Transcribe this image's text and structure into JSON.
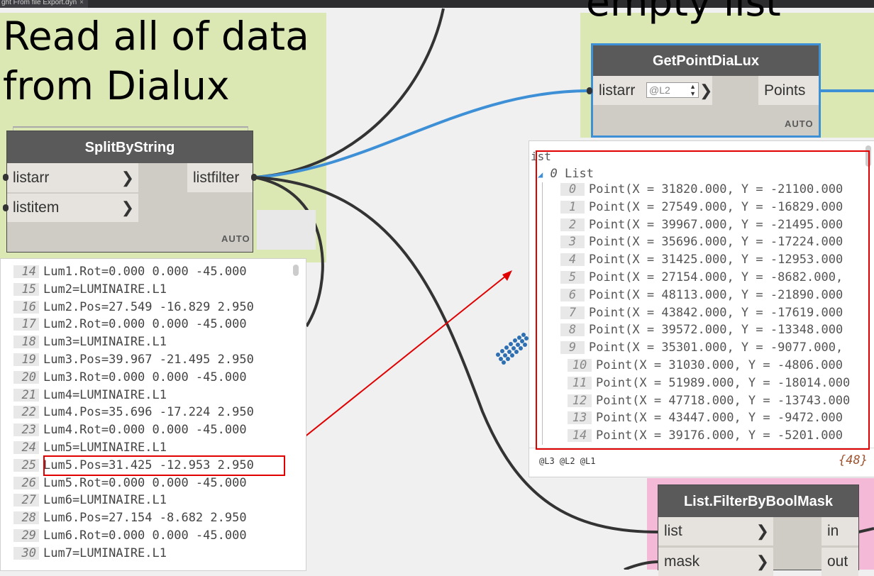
{
  "tab": {
    "label": "ght From file Export.dyn",
    "close": "×"
  },
  "groups": {
    "left_title_line1": "Read all of data",
    "left_title_line2": "from Dialux",
    "right_title": "empty list"
  },
  "split_node": {
    "title": "SplitByString",
    "inputs": [
      "listarr",
      "listitem"
    ],
    "output": "listfilter",
    "lacing": "AUTO"
  },
  "getpoint_node": {
    "title": "GetPointDiaLux",
    "input": "listarr",
    "level_value": "@L2",
    "output": "Points",
    "lacing": "AUTO"
  },
  "filter_node": {
    "title": "List.FilterByBoolMask",
    "inputs": [
      "list",
      "mask"
    ],
    "outputs": [
      "in",
      "out"
    ]
  },
  "text_preview": {
    "lines": [
      {
        "n": "14",
        "text": "Lum1.Rot=0.000 0.000 -45.000"
      },
      {
        "n": "15",
        "text": "Lum2=LUMINAIRE.L1"
      },
      {
        "n": "16",
        "text": "Lum2.Pos=27.549 -16.829 2.950"
      },
      {
        "n": "17",
        "text": "Lum2.Rot=0.000 0.000 -45.000"
      },
      {
        "n": "18",
        "text": "Lum3=LUMINAIRE.L1"
      },
      {
        "n": "19",
        "text": "Lum3.Pos=39.967 -21.495 2.950"
      },
      {
        "n": "20",
        "text": "Lum3.Rot=0.000 0.000 -45.000"
      },
      {
        "n": "21",
        "text": "Lum4=LUMINAIRE.L1"
      },
      {
        "n": "22",
        "text": "Lum4.Pos=35.696 -17.224 2.950"
      },
      {
        "n": "23",
        "text": "Lum4.Rot=0.000 0.000 -45.000"
      },
      {
        "n": "24",
        "text": "Lum5=LUMINAIRE.L1"
      },
      {
        "n": "25",
        "text": "Lum5.Pos=31.425 -12.953 2.950"
      },
      {
        "n": "26",
        "text": "Lum5.Rot=0.000 0.000 -45.000"
      },
      {
        "n": "27",
        "text": "Lum6=LUMINAIRE.L1"
      },
      {
        "n": "28",
        "text": "Lum6.Pos=27.154 -8.682 2.950"
      },
      {
        "n": "29",
        "text": "Lum6.Rot=0.000 0.000 -45.000"
      },
      {
        "n": "30",
        "text": "Lum7=LUMINAIRE.L1"
      }
    ]
  },
  "point_preview": {
    "header": "ist",
    "sublist_index": "0",
    "sublist_label": "List",
    "points": [
      {
        "n": "0",
        "text": "Point(X = 31820.000, Y = -21100.000"
      },
      {
        "n": "1",
        "text": "Point(X = 27549.000, Y = -16829.000"
      },
      {
        "n": "2",
        "text": "Point(X = 39967.000, Y = -21495.000"
      },
      {
        "n": "3",
        "text": "Point(X = 35696.000, Y = -17224.000"
      },
      {
        "n": "4",
        "text": "Point(X = 31425.000, Y = -12953.000"
      },
      {
        "n": "5",
        "text": "Point(X = 27154.000, Y = -8682.000,"
      },
      {
        "n": "6",
        "text": "Point(X = 48113.000, Y = -21890.000"
      },
      {
        "n": "7",
        "text": "Point(X = 43842.000, Y = -17619.000"
      },
      {
        "n": "8",
        "text": "Point(X = 39572.000, Y = -13348.000"
      },
      {
        "n": "9",
        "text": "Point(X = 35301.000, Y = -9077.000,"
      },
      {
        "n": "10",
        "text": "Point(X = 31030.000, Y = -4806.000"
      },
      {
        "n": "11",
        "text": "Point(X = 51989.000, Y = -18014.000"
      },
      {
        "n": "12",
        "text": "Point(X = 47718.000, Y = -13743.000"
      },
      {
        "n": "13",
        "text": "Point(X = 43447.000, Y = -9472.000"
      },
      {
        "n": "14",
        "text": "Point(X = 39176.000, Y = -5201.000"
      }
    ],
    "levels": "@L3 @L2 @L1",
    "count": "{48}"
  },
  "colors": {
    "group_green": "#dce8b4",
    "group_pink": "#f4b9d6",
    "wire_selected": "#3d8fd6",
    "wire": "#333333",
    "highlight_red": "#e00000",
    "node_header": "#5a5a5a"
  }
}
